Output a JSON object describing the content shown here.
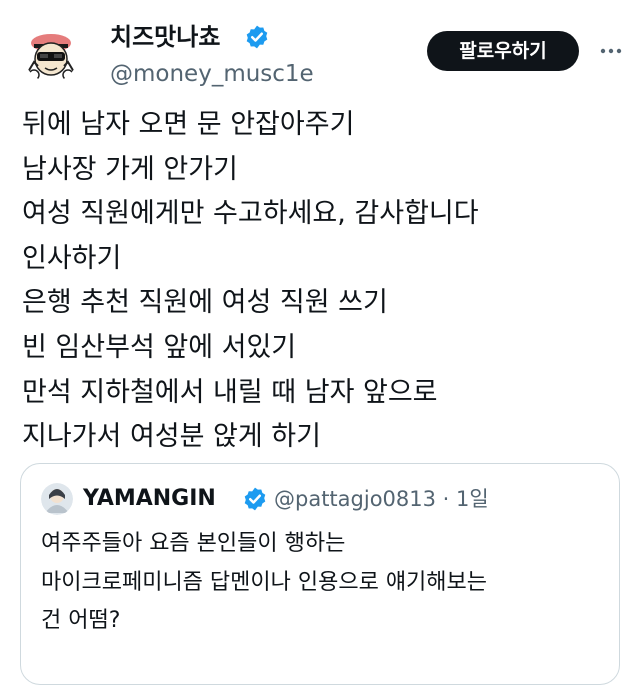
{
  "author": {
    "display_name": "치즈맛나쵸",
    "handle": "@money_musc1e",
    "verified_icon": "verified-badge-icon",
    "avatar_icon": "cartoon-character-avatar"
  },
  "follow_button": {
    "label": "팔로우하기"
  },
  "more_menu": {
    "icon": "more-horizontal-icon"
  },
  "tweet": {
    "lines": [
      "뒤에 남자 오면 문 안잡아주기",
      "남사장 가게 안가기",
      "여성 직원에게만 수고하세요, 감사합니다",
      "인사하기",
      "은행 추천 직원에 여성 직원 쓰기",
      "빈 임산부석 앞에 서있기",
      "만석 지하철에서 내릴 때 남자 앞으로",
      "지나가서 여성분 앉게 하기"
    ]
  },
  "quoted_tweet": {
    "display_name": "YAMANGIN",
    "meta": "@pattagjo0813 · 1일",
    "lines": [
      "여주주들아 요즘 본인들이 행하는",
      "마이크로페미니즘 답멘이나 인용으로 얘기해보는",
      "건 어떰?"
    ]
  },
  "colors": {
    "text": "#0f1419",
    "secondary_text": "#536471",
    "verified_blue": "#1d9bf0",
    "follow_button_bg": "#0f1419",
    "border": "#cfd9de"
  }
}
